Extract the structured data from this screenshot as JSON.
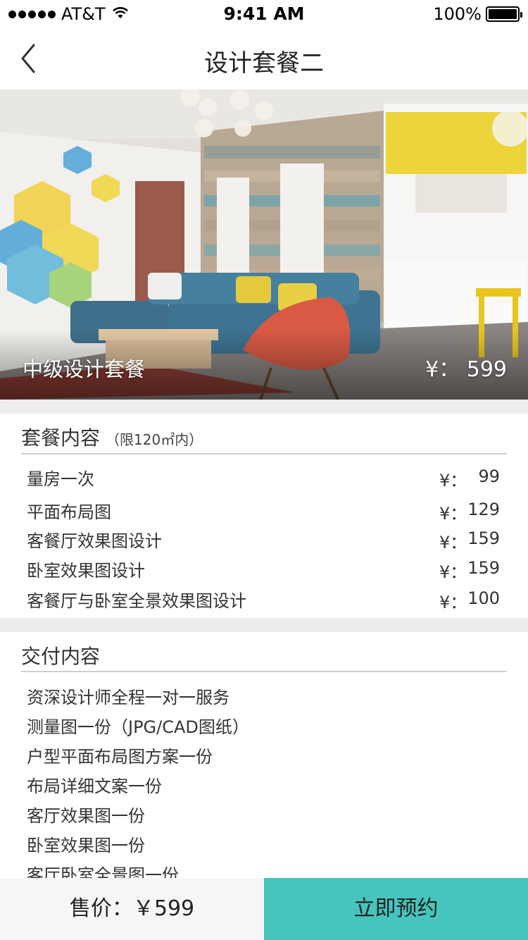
{
  "status_bar": {
    "carrier": "AT&T",
    "time": "9:41 AM",
    "battery": "100%"
  },
  "nav": {
    "title": "设计套餐二"
  },
  "hero": {
    "caption": "中级设计套餐",
    "price": "¥： 599"
  },
  "package": {
    "title": "套餐内容",
    "subtitle": "（限120㎡内）",
    "currency": "¥：",
    "items": [
      {
        "label": "量房一次",
        "price": "99"
      },
      {
        "label": "平面布局图",
        "price": "129"
      },
      {
        "label": "客餐厅效果图设计",
        "price": "159"
      },
      {
        "label": "卧室效果图设计",
        "price": "159"
      },
      {
        "label": "客餐厅与卧室全景效果图设计",
        "price": "100"
      }
    ]
  },
  "delivery": {
    "title": "交付内容",
    "items": [
      "资深设计师全程一对一服务",
      "测量图一份（JPG/CAD图纸）",
      "户型平面布局图方案一份",
      "布局详细文案一份",
      "客厅效果图一份",
      "卧室效果图一份",
      "客厅卧室全景图一份"
    ]
  },
  "bottom": {
    "price_label": "售价：￥599",
    "book_label": "立即预约"
  },
  "colors": {
    "accent": "#45c5bd",
    "section_gap": "#ededed"
  }
}
